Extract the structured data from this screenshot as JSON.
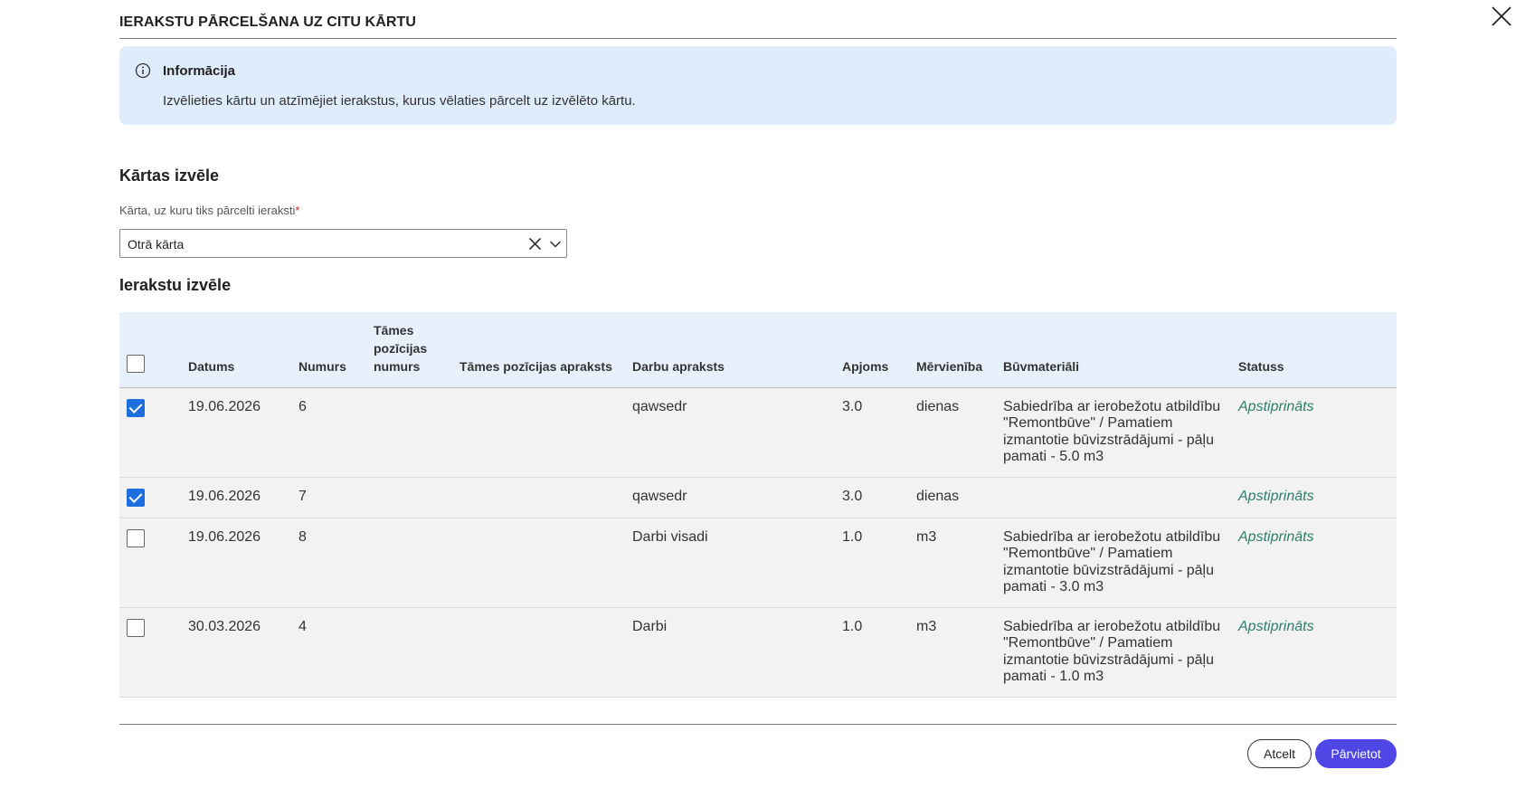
{
  "dialog": {
    "title": "IERAKSTU PĀRCELŠANA UZ CITU KĀRTU",
    "info": {
      "title": "Informācija",
      "text": "Izvēlieties kārtu un atzīmējiet ierakstus, kurus vēlaties pārcelt uz izvēlēto kārtu."
    },
    "layer_section": {
      "title": "Kārtas izvēle",
      "field_label": "Kārta, uz kuru tiks pārcelti ieraksti",
      "required_mark": "*",
      "selected_value": "Otrā kārta"
    },
    "records_section": {
      "title": "Ierakstu izvēle",
      "columns": {
        "date": "Datums",
        "number": "Numurs",
        "position_number": "Tāmes pozīcijas numurs",
        "position_description": "Tāmes pozīcijas apraksts",
        "work_description": "Darbu apraksts",
        "volume": "Apjoms",
        "unit": "Mērvienība",
        "materials": "Būvmateriāli",
        "status": "Statuss"
      },
      "rows": [
        {
          "checked": true,
          "date": "19.06.2026",
          "number": "6",
          "position_number": "",
          "position_description": "",
          "work_description": "qawsedr",
          "volume": "3.0",
          "unit": "dienas",
          "materials": "Sabiedrība ar ierobežotu atbildību \"Remontbūve\" / Pamatiem izmantotie būvizstrādājumi - pāļu pamati - 5.0 m3",
          "status": "Apstiprināts"
        },
        {
          "checked": true,
          "date": "19.06.2026",
          "number": "7",
          "position_number": "",
          "position_description": "",
          "work_description": "qawsedr",
          "volume": "3.0",
          "unit": "dienas",
          "materials": "",
          "status": "Apstiprināts"
        },
        {
          "checked": false,
          "date": "19.06.2026",
          "number": "8",
          "position_number": "",
          "position_description": "",
          "work_description": "Darbi visadi",
          "volume": "1.0",
          "unit": "m3",
          "materials": "Sabiedrība ar ierobežotu atbildību \"Remontbūve\" / Pamatiem izmantotie būvizstrādājumi - pāļu pamati - 3.0 m3",
          "status": "Apstiprināts"
        },
        {
          "checked": false,
          "date": "30.03.2026",
          "number": "4",
          "position_number": "",
          "position_description": "",
          "work_description": "Darbi",
          "volume": "1.0",
          "unit": "m3",
          "materials": "Sabiedrība ar ierobežotu atbildību \"Remontbūve\" / Pamatiem izmantotie būvizstrādājumi - pāļu pamati - 1.0 m3",
          "status": "Apstiprināts"
        }
      ]
    },
    "buttons": {
      "cancel": "Atcelt",
      "move": "Pārvietot"
    }
  },
  "colors": {
    "accent": "#4f46e5",
    "checkbox": "#1d6fe0",
    "info_bg": "#deecfb",
    "status_text": "#2e7d6b"
  },
  "icons": {
    "close": "close-icon",
    "info": "info-icon",
    "clear": "clear-icon",
    "chevron": "chevron-down-icon"
  }
}
